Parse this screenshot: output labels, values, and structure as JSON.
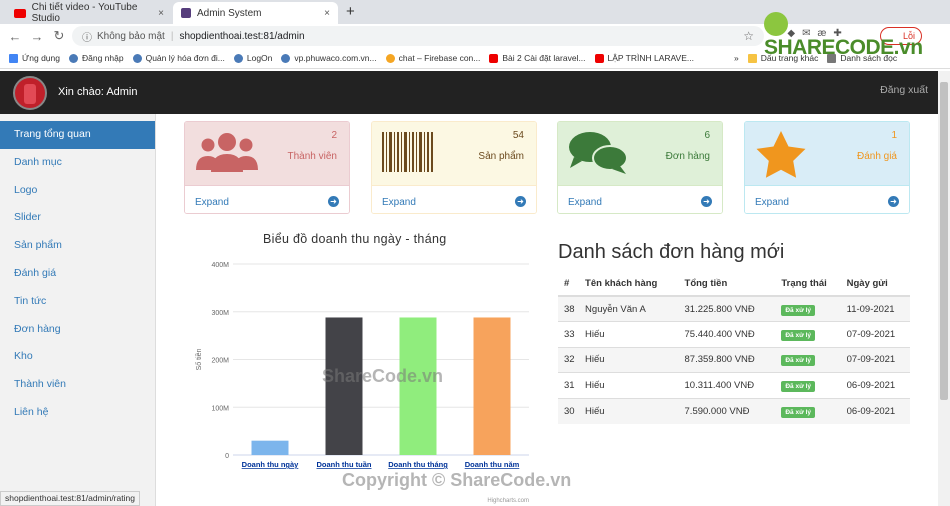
{
  "browser": {
    "tabs": [
      {
        "title": "Chi tiết video - YouTube Studio",
        "close": "×"
      },
      {
        "title": "Admin System",
        "close": "×"
      }
    ],
    "new_tab": "+",
    "insecure_label": "Không bảo mật",
    "url": "shopdienthoai.test:81/admin",
    "profile_label": "Lỗi",
    "bookmarks": [
      "Ứng dụng",
      "Đăng nhập",
      "Quản lý hóa đơn đi...",
      "LogOn",
      "vp.phuwaco.com.vn...",
      "chat – Firebase con...",
      "Bài 2 Cài đặt laravel...",
      "LẬP TRÌNH LARAVE..."
    ],
    "bookmarks_more": "»",
    "bookmark_folder": "Dấu trang khác",
    "reading_list": "Danh sách đọc",
    "status_url": "shopdienthoai.test:81/admin/rating"
  },
  "header": {
    "greeting": "Xin chào: Admin",
    "logout": "Đăng xuất"
  },
  "sidebar": {
    "items": [
      {
        "label": "Trang tổng quan"
      },
      {
        "label": "Danh mục"
      },
      {
        "label": "Logo"
      },
      {
        "label": "Slider"
      },
      {
        "label": "Sản phẩm"
      },
      {
        "label": "Đánh giá"
      },
      {
        "label": "Tin tức"
      },
      {
        "label": "Đơn hàng"
      },
      {
        "label": "Kho"
      },
      {
        "label": "Thành viên"
      },
      {
        "label": "Liên hệ"
      }
    ]
  },
  "panels": [
    {
      "count": "2",
      "label": "Thành viên",
      "expand": "Expand",
      "icon": "users-icon",
      "bg": "#f2dede",
      "border": "#ebccd1",
      "iconColor": "#c86464"
    },
    {
      "count": "54",
      "label": "Sản phẩm",
      "expand": "Expand",
      "icon": "barcode-icon",
      "bg": "#fcf8e3",
      "border": "#faebcc",
      "iconColor": "#6b4a1e"
    },
    {
      "count": "6",
      "label": "Đơn hàng",
      "expand": "Expand",
      "icon": "comments-icon",
      "bg": "#dff0d8",
      "border": "#d6e9c6",
      "iconColor": "#3c7a3a"
    },
    {
      "count": "1",
      "label": "Đánh giá",
      "expand": "Expand",
      "icon": "star-icon",
      "bg": "#d9edf7",
      "border": "#bce8f1",
      "iconColor": "#f0961e"
    }
  ],
  "chart_data": {
    "type": "bar",
    "title": "Biểu đồ doanh thu ngày - tháng",
    "ylabel": "Số tiền",
    "xlabel": "",
    "categories": [
      "Doanh thu ngày",
      "Doanh thu tuần",
      "Doanh thu tháng",
      "Doanh thu năm"
    ],
    "values": [
      30,
      288,
      288,
      288
    ],
    "value_unit": "M",
    "colors": [
      "#7cb5ec",
      "#434348",
      "#90ed7d",
      "#f7a35c"
    ],
    "ylim": [
      0,
      400
    ],
    "yticks": [
      "0",
      "100M",
      "200M",
      "300M",
      "400M"
    ],
    "credits": "Highcharts.com",
    "grid": true,
    "legend": "none"
  },
  "orders": {
    "title": "Danh sách đơn hàng mới",
    "headers": [
      "#",
      "Tên khách hàng",
      "Tổng tiền",
      "Trạng thái",
      "Ngày gửi"
    ],
    "rows": [
      [
        "38",
        "Nguyễn Văn A",
        "31.225.800 VNĐ",
        "Đã xử lý",
        "11-09-2021"
      ],
      [
        "33",
        "Hiếu",
        "75.440.400 VNĐ",
        "Đã xử lý",
        "07-09-2021"
      ],
      [
        "32",
        "Hiếu",
        "87.359.800 VNĐ",
        "Đã xử lý",
        "07-09-2021"
      ],
      [
        "31",
        "Hiếu",
        "10.311.400 VNĐ",
        "Đã xử lý",
        "06-09-2021"
      ],
      [
        "30",
        "Hiếu",
        "7.590.000 VNĐ",
        "Đã xử lý",
        "06-09-2021"
      ]
    ]
  },
  "watermarks": {
    "logo": "SHARECODE.vn",
    "center": "ShareCode.vn",
    "copyright": "Copyright © ShareCode.vn"
  }
}
